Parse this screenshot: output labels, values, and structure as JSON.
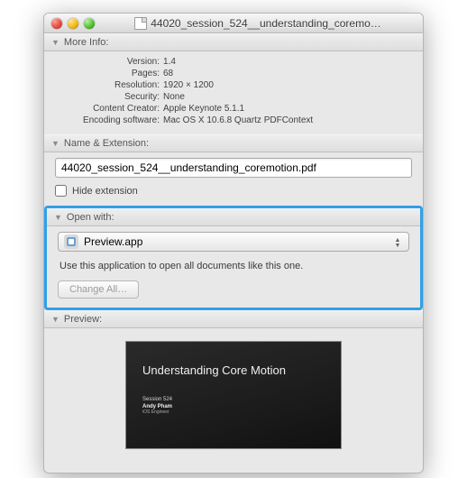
{
  "window": {
    "title": "44020_session_524__understanding_coremo…"
  },
  "more_info": {
    "header": "More Info:",
    "rows": {
      "version_k": "Version:",
      "version_v": "1.4",
      "pages_k": "Pages:",
      "pages_v": "68",
      "resolution_k": "Resolution:",
      "resolution_v": "1920 × 1200",
      "security_k": "Security:",
      "security_v": "None",
      "creator_k": "Content Creator:",
      "creator_v": "Apple Keynote 5.1.1",
      "encoding_k": "Encoding software:",
      "encoding_v": "Mac OS X 10.6.8 Quartz PDFContext"
    }
  },
  "name_ext": {
    "header": "Name & Extension:",
    "filename": "44020_session_524__understanding_coremotion.pdf",
    "hide_label": "Hide extension"
  },
  "open_with": {
    "header": "Open with:",
    "app": "Preview.app",
    "hint": "Use this application to open all documents like this one.",
    "change_all": "Change All…"
  },
  "preview": {
    "header": "Preview:",
    "slide_title": "Understanding Core Motion",
    "slide_session": "Session 524",
    "slide_speaker": "Andy Pham",
    "slide_role": "iOS Engineer",
    "slide_logo": ""
  }
}
